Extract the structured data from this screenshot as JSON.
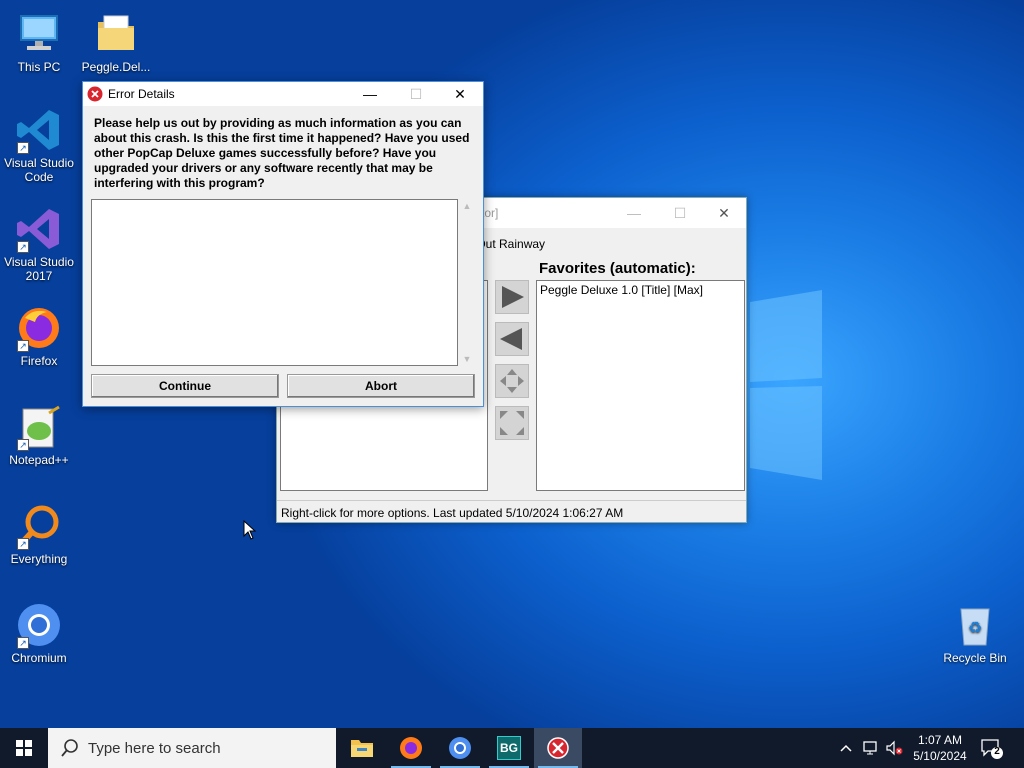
{
  "desktop": {
    "icons": [
      {
        "label": "This PC"
      },
      {
        "label": "Peggle.Del..."
      },
      {
        "label": "Visual Studio Code"
      },
      {
        "label": "Visual Studio 2017"
      },
      {
        "label": "Firefox"
      },
      {
        "label": "Notepad++"
      },
      {
        "label": "Everything"
      },
      {
        "label": "Chromium"
      },
      {
        "label": "Recycle Bin"
      }
    ]
  },
  "back_window": {
    "title_fragment": "trator]",
    "row_label": "k Out Rainway",
    "favorites_title": "Favorites (automatic):",
    "favorites_items": [
      "Peggle Deluxe 1.0 [Title] [Max]"
    ],
    "status": "Right-click for more options. Last updated 5/10/2024 1:06:27 AM"
  },
  "error_dialog": {
    "title": "Error Details",
    "message": "Please help us out by providing as much information as you can about this crash. Is this the first time it happened? Have you used other PopCap Deluxe games successfully before? Have you upgraded your drivers or any software recently that may be interfering with this program?",
    "details_value": "",
    "continue_label": "Continue",
    "abort_label": "Abort",
    "minimize_glyph": "—",
    "maximize_glyph": "☐",
    "close_glyph": "✕"
  },
  "taskbar": {
    "search_placeholder": "Type here to search",
    "bg_app_label": "BG",
    "time": "1:07 AM",
    "date": "5/10/2024",
    "notification_count": "2"
  },
  "colors": {
    "taskbar_bg": "#101a2b",
    "accent": "#0078d7",
    "error_red": "#d8262e"
  }
}
